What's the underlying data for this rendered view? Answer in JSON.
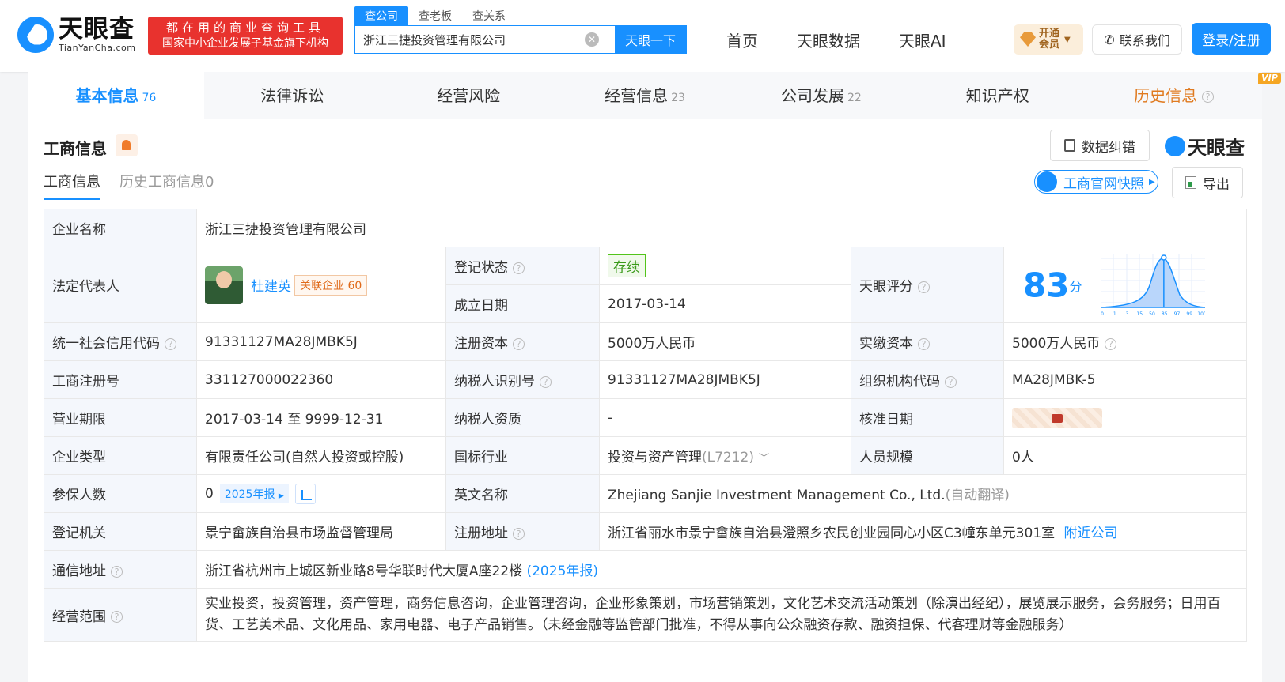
{
  "header": {
    "logo_cn": "天眼查",
    "logo_en": "TianYanCha.com",
    "slogan_line1": "都在用的商业查询工具",
    "slogan_line2": "国家中小企业发展子基金旗下机构",
    "search_tabs": [
      "查公司",
      "查老板",
      "查关系"
    ],
    "search_value": "浙江三捷投资管理有限公司",
    "search_button": "天眼一下",
    "nav": [
      "首页",
      "天眼数据",
      "天眼AI"
    ],
    "vip_line1": "开通",
    "vip_line2": "会员",
    "contact": "联系我们",
    "login": "登录/注册"
  },
  "tabs": [
    {
      "label": "基本信息",
      "count": "76"
    },
    {
      "label": "法律诉讼",
      "count": ""
    },
    {
      "label": "经营风险",
      "count": ""
    },
    {
      "label": "经营信息",
      "count": "23"
    },
    {
      "label": "公司发展",
      "count": "22"
    },
    {
      "label": "知识产权",
      "count": ""
    },
    {
      "label": "历史信息",
      "count": "",
      "badge": "VIP"
    }
  ],
  "section": {
    "title": "工商信息",
    "report_button": "数据纠错",
    "brand": "天眼查",
    "sub_tabs": [
      "工商信息",
      "历史工商信息0"
    ],
    "snapshot_button": "工商官网快照",
    "export_button": "导出"
  },
  "info": {
    "company_name_label": "企业名称",
    "company_name": "浙江三捷投资管理有限公司",
    "legal_rep_label": "法定代表人",
    "legal_rep": "杜建英",
    "related_label": "关联企业",
    "related_count": "60",
    "reg_status_label": "登记状态",
    "reg_status": "存续",
    "found_date_label": "成立日期",
    "found_date": "2017-03-14",
    "score_label": "天眼评分",
    "score": "83",
    "score_unit": "分",
    "credit_code_label": "统一社会信用代码",
    "credit_code": "91331127MA28JMBK5J",
    "reg_capital_label": "注册资本",
    "reg_capital": "5000万人民币",
    "paid_capital_label": "实缴资本",
    "paid_capital": "5000万人民币",
    "reg_no_label": "工商注册号",
    "reg_no": "331127000022360",
    "tax_id_label": "纳税人识别号",
    "tax_id": "91331127MA28JMBK5J",
    "org_code_label": "组织机构代码",
    "org_code": "MA28JMBK-5",
    "term_label": "营业期限",
    "term": "2017-03-14 至 9999-12-31",
    "tax_qual_label": "纳税人资质",
    "tax_qual": "-",
    "approve_date_label": "核准日期",
    "type_label": "企业类型",
    "type": "有限责任公司(自然人投资或控股)",
    "industry_label": "国标行业",
    "industry": "投资与资产管理",
    "industry_code": "(L7212)",
    "staff_label": "人员规模",
    "staff": "0人",
    "insured_label": "参保人数",
    "insured": "0",
    "insured_year": "2025年报",
    "en_name_label": "英文名称",
    "en_name": "Zhejiang Sanjie Investment Management Co., Ltd.",
    "en_name_note": "(自动翻译)",
    "authority_label": "登记机关",
    "authority": "景宁畲族自治县市场监督管理局",
    "reg_addr_label": "注册地址",
    "reg_addr": "浙江省丽水市景宁畲族自治县澄照乡农民创业园同心小区C3幢东单元301室",
    "nearby": "附近公司",
    "mail_addr_label": "通信地址",
    "mail_addr": "浙江省杭州市上城区新业路8号华联时代大厦A座22楼",
    "mail_addr_year": "(2025年报)",
    "scope_label": "经营范围",
    "scope": "实业投资，投资管理，资产管理，商务信息咨询，企业管理咨询，企业形象策划，市场营销策划，文化艺术交流活动策划（除演出经纪），展览展示服务，会务服务；日用百货、工艺美术品、文化用品、家用电器、电子产品销售。（未经金融等监管部门批准，不得从事向公众融资存款、融资担保、代客理财等金融服务）"
  },
  "score_chart": {
    "x_ticks": [
      "0",
      "1",
      "3",
      "15",
      "50",
      "85",
      "97",
      "99",
      "100"
    ],
    "marker_value": 83,
    "accent": "#1890ff"
  }
}
